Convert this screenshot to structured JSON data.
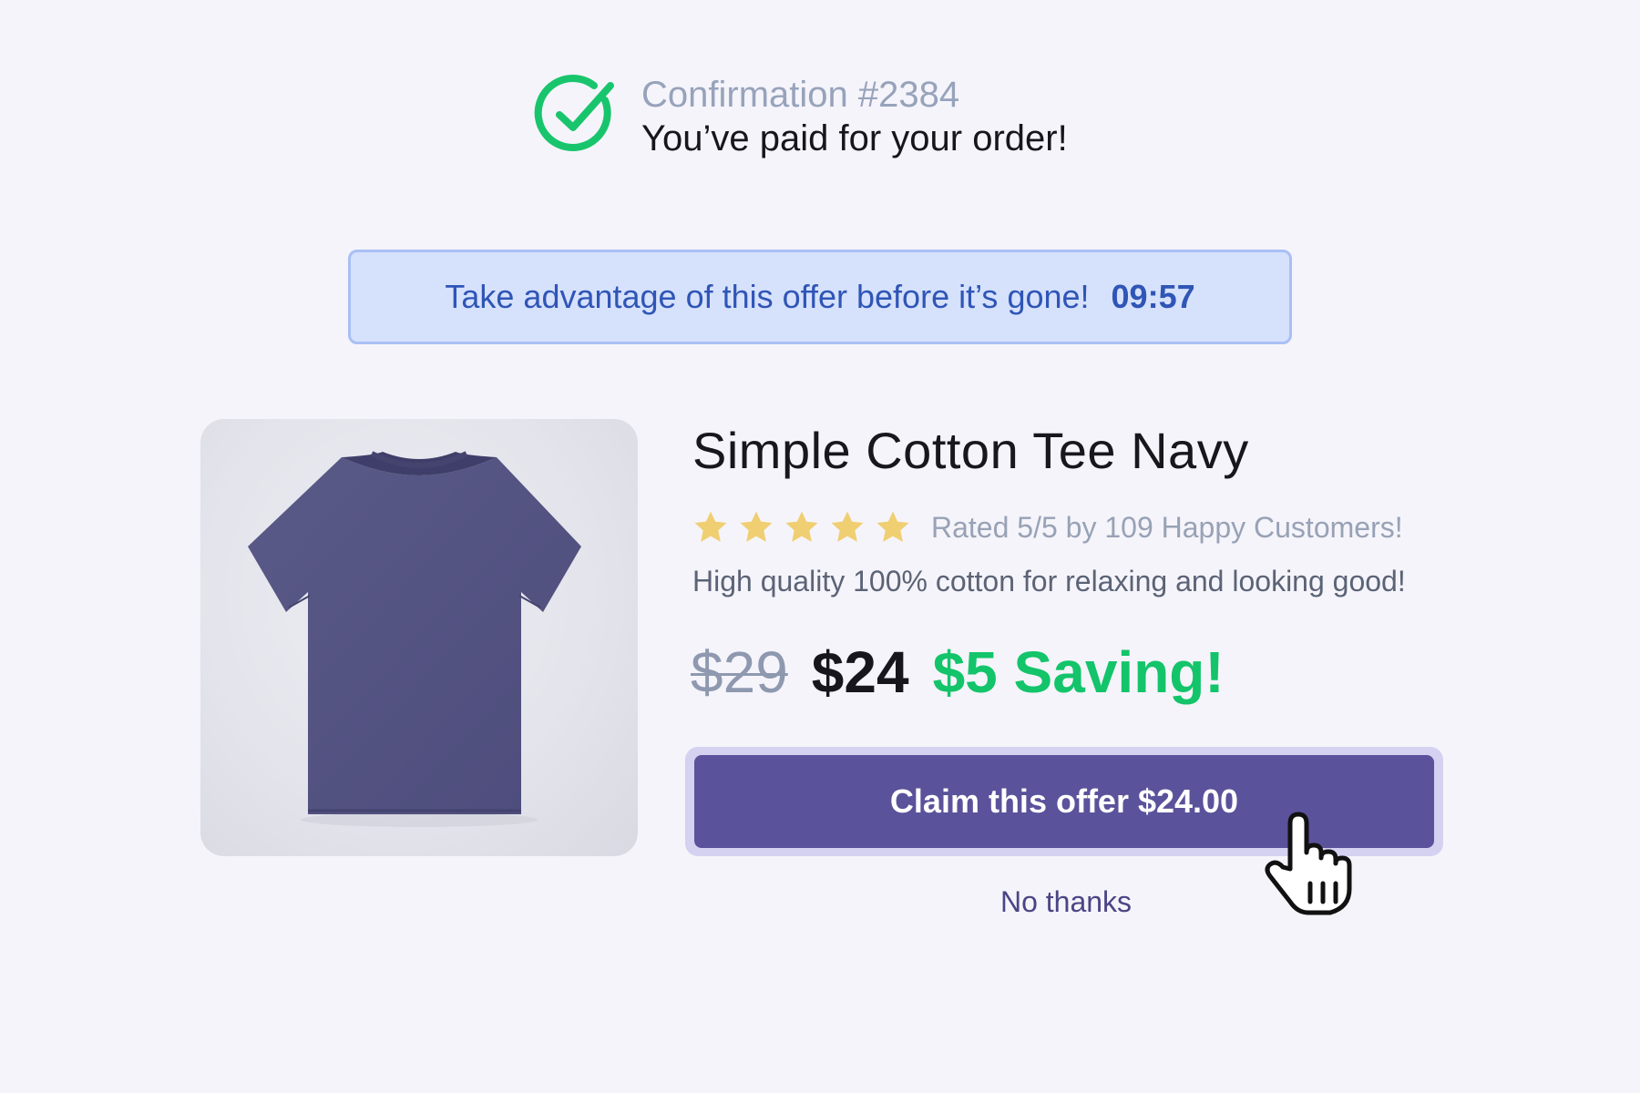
{
  "confirmation": {
    "number": "Confirmation #2384",
    "message": "You’ve paid for your order!",
    "icon": "check-circle-icon",
    "color": "#18c56d"
  },
  "offer": {
    "text": "Take advantage of this offer before it’s gone!",
    "timer": "09:57",
    "bg_color": "#d6e1fc",
    "text_color": "#2f55b6"
  },
  "product": {
    "image": "navy-tshirt-image",
    "title": "Simple Cotton Tee Navy",
    "rating_stars": 5,
    "rating_max": 5,
    "rating_text": "Rated 5/5 by 109 Happy Customers!",
    "description": "High quality 100% cotton for relaxing and looking good!",
    "old_price": "$29",
    "new_price": "$24",
    "saving": "$5 Saving!",
    "star_color": "#f0cf72",
    "saving_color": "#13c46a"
  },
  "actions": {
    "claim_label": "Claim this offer $24.00",
    "decline_label": "No thanks",
    "button_color": "#5a529a"
  },
  "cursor": {
    "icon": "hand-pointer-icon"
  }
}
